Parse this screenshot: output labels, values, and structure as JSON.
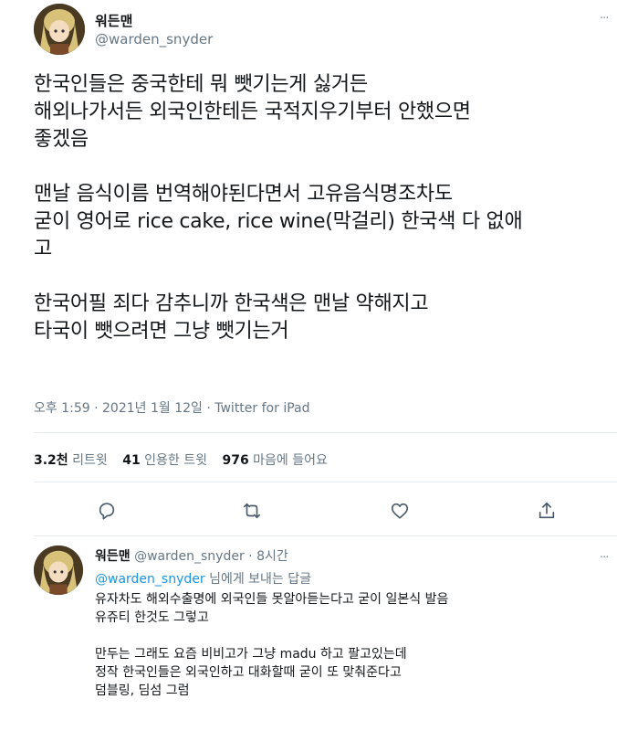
{
  "tweet": {
    "author_name": "워든맨",
    "author_handle": "@warden_snyder",
    "more_glyph": "···",
    "paragraphs": [
      [
        "한국인들은 중국한테 뭐 뺏기는게 싫거든",
        "해외나가서든 외국인한테든 국적지우기부터 안했으면",
        "좋겠음"
      ],
      [
        "맨날 음식이름 번역해야된다면서 고유음식명조차도",
        "굳이 영어로 rice cake, rice wine(막걸리) 한국색 다 없애",
        "고"
      ],
      [
        "한국어필 죄다 감추니까 한국색은 맨날 약해지고",
        "타국이 뺏으려면 그냥 뺏기는거"
      ]
    ],
    "meta": "오후 1:59 · 2021년 1월 12일 · Twitter for iPad",
    "stats": {
      "retweets_count": "3.2천",
      "retweets_label": "리트윗",
      "quotes_count": "41",
      "quotes_label": "인용한 트윗",
      "likes_count": "976",
      "likes_label": "마음에 들어요"
    },
    "actions": {
      "reply_icon": "reply-icon",
      "retweet_icon": "retweet-icon",
      "like_icon": "heart-icon",
      "share_icon": "share-icon"
    }
  },
  "reply": {
    "author_name": "워든맨",
    "author_handle": "@warden_snyder",
    "time": "· 8시간",
    "reply_to_mention": "@warden_snyder",
    "reply_to_suffix": "님에게 보내는 답글",
    "paragraphs": [
      [
        "유자차도 해외수출명에 외국인들 못알아듣는다고 굳이 일본식 발음",
        "유쥬티 한것도 그렇고"
      ],
      [
        "만두는 그래도 요즘 비비고가 그냥 madu 하고 팔고있는데",
        "정작 한국인들은 외국인하고 대화할때 굳이 또 맞춰준다고",
        "덤블링, 딤섬  그럼"
      ]
    ]
  },
  "colors": {
    "text": "#14171a",
    "secondary": "#657786",
    "link": "#1b95e0",
    "divider": "#e6ecf0",
    "icon": "#4a5a6a"
  }
}
